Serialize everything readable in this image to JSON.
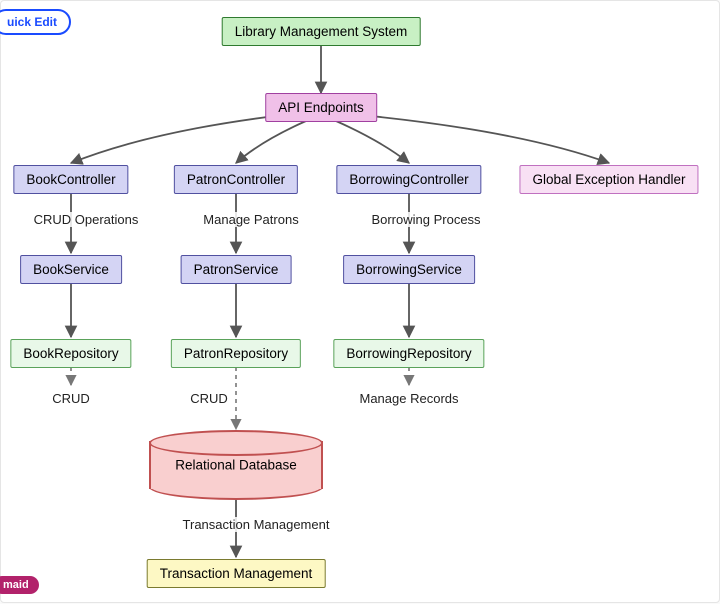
{
  "ui": {
    "quick_edit": "uick Edit",
    "maid_badge": "maid"
  },
  "nodes": {
    "root": {
      "label": "Library Management System"
    },
    "api": {
      "label": "API Endpoints"
    },
    "book_ctrl": {
      "label": "BookController"
    },
    "patron_ctrl": {
      "label": "PatronController"
    },
    "borrow_ctrl": {
      "label": "BorrowingController"
    },
    "exc_handler": {
      "label": "Global Exception Handler"
    },
    "book_svc": {
      "label": "BookService"
    },
    "patron_svc": {
      "label": "PatronService"
    },
    "borrow_svc": {
      "label": "BorrowingService"
    },
    "book_repo": {
      "label": "BookRepository"
    },
    "patron_repo": {
      "label": "PatronRepository"
    },
    "borrow_repo": {
      "label": "BorrowingRepository"
    },
    "db": {
      "label": "Relational Database"
    },
    "txn": {
      "label": "Transaction Management"
    }
  },
  "edges": {
    "book_ops": "CRUD Operations",
    "patron_ops": "Manage Patrons",
    "borrow_ops": "Borrowing Process",
    "book_crud": "CRUD",
    "patron_crud": "CRUD",
    "borrow_rec": "Manage Records",
    "txn_mgmt": "Transaction Management"
  }
}
